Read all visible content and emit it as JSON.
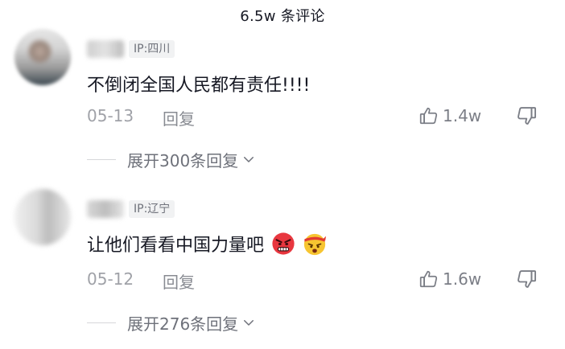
{
  "header": {
    "title": "6.5w 条评论"
  },
  "comments": [
    {
      "ip_label": "IP:四川",
      "text": "不倒闭全国人民都有责任!!!!",
      "date": "05-13",
      "reply_label": "回复",
      "like_count": "1.4w",
      "expand_label": "展开300条回复",
      "icons": {
        "like": "thumb-up-icon",
        "dislike": "thumb-down-icon",
        "expand": "chevron-down-icon"
      }
    },
    {
      "ip_label": "IP:辽宁",
      "text": "让他们看看中国力量吧",
      "date": "05-12",
      "reply_label": "回复",
      "like_count": "1.6w",
      "expand_label": "展开276条回复",
      "emojis": [
        "angry-face-emoji",
        "fighting-headband-emoji"
      ],
      "icons": {
        "like": "thumb-up-icon",
        "dislike": "thumb-down-icon",
        "expand": "chevron-down-icon"
      }
    }
  ],
  "colors": {
    "text_primary": "#161823",
    "text_secondary": "#a0a2a8",
    "badge_bg": "#f1f2f3"
  }
}
